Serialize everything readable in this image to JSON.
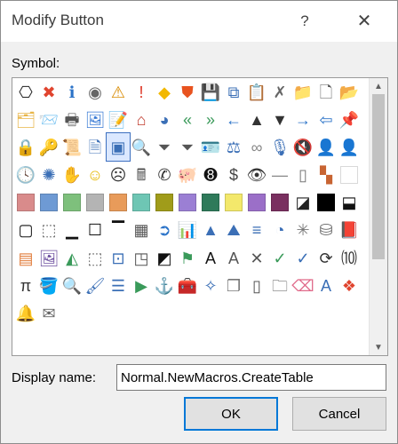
{
  "window": {
    "title": "Modify Button",
    "help_label": "?",
    "close_label": "✕"
  },
  "symbol_section": {
    "label": "Symbol:"
  },
  "symbols": [
    {
      "name": "org-chart-icon",
      "g": "⎔",
      "c": "#222"
    },
    {
      "name": "delete-circle-icon",
      "g": "✖",
      "c": "#e0442e"
    },
    {
      "name": "info-icon",
      "g": "ℹ",
      "c": "#2b73c8"
    },
    {
      "name": "target-icon",
      "g": "◉",
      "c": "#666"
    },
    {
      "name": "warning-icon",
      "g": "⚠",
      "c": "#d88a00"
    },
    {
      "name": "exclamation-icon",
      "g": "!",
      "c": "#d32"
    },
    {
      "name": "warning-diamond-icon",
      "g": "◆",
      "c": "#f2b800"
    },
    {
      "name": "shield-icon",
      "g": "⛊",
      "c": "#e8531f"
    },
    {
      "name": "save-icon",
      "g": "💾",
      "c": "#5b3a8c"
    },
    {
      "name": "copy-icon",
      "g": "⧉",
      "c": "#3b6fb6"
    },
    {
      "name": "paste-icon",
      "g": "📋",
      "c": "#6d4fa0"
    },
    {
      "name": "delete-icon",
      "g": "✗",
      "c": "#666"
    },
    {
      "name": "folder-icon",
      "g": "📁",
      "c": "#e8b64a"
    },
    {
      "name": "page-icon",
      "g": "🗋",
      "c": "#555"
    },
    {
      "name": "open-folder-icon",
      "g": "📂",
      "c": "#e8b64a"
    },
    {
      "name": "folders-icon",
      "g": "🗂",
      "c": "#e8b64a"
    },
    {
      "name": "mail-folder-icon",
      "g": "📨",
      "c": "#e8b64a"
    },
    {
      "name": "print-icon",
      "g": "🖶",
      "c": "#555"
    },
    {
      "name": "image-icon",
      "g": "🖼",
      "c": "#3a7bd5"
    },
    {
      "name": "note-icon",
      "g": "📝",
      "c": "#e2b13c"
    },
    {
      "name": "home-icon",
      "g": "⌂",
      "c": "#c0392b"
    },
    {
      "name": "pie-chart-icon",
      "g": "◕",
      "c": "#3b6fb6"
    },
    {
      "name": "double-left-icon",
      "g": "«",
      "c": "#3a9a5a"
    },
    {
      "name": "double-right-icon",
      "g": "»",
      "c": "#3a9a5a"
    },
    {
      "name": "arrow-left-icon",
      "g": "←",
      "c": "#2b73c8"
    },
    {
      "name": "triangle-up-icon",
      "g": "▲",
      "c": "#333"
    },
    {
      "name": "triangle-down-icon",
      "g": "▼",
      "c": "#333"
    },
    {
      "name": "arrow-right-icon",
      "g": "→",
      "c": "#2b73c8"
    },
    {
      "name": "back-circle-icon",
      "g": "⇦",
      "c": "#2b73c8"
    },
    {
      "name": "pin-icon",
      "g": "📌",
      "c": "#555"
    },
    {
      "name": "lock-icon",
      "g": "🔒",
      "c": "#d4a017"
    },
    {
      "name": "key-icon",
      "g": "🔑",
      "c": "#777"
    },
    {
      "name": "scroll-icon",
      "g": "📜",
      "c": "#777"
    },
    {
      "name": "document-arrow-icon",
      "g": "🗎",
      "c": "#3b6fb6"
    },
    {
      "name": "window-select-icon",
      "g": "▣",
      "c": "#3b6fb6",
      "sel": true
    },
    {
      "name": "magnifier-icon",
      "g": "🔍",
      "c": "#444"
    },
    {
      "name": "filter-icon",
      "g": "⏷",
      "c": "#555"
    },
    {
      "name": "filter2-icon",
      "g": "⏷",
      "c": "#555"
    },
    {
      "name": "contact-card-icon",
      "g": "🪪",
      "c": "#3b6fb6"
    },
    {
      "name": "scales-icon",
      "g": "⚖",
      "c": "#3b6fb6"
    },
    {
      "name": "rings-icon",
      "g": "∞",
      "c": "#888"
    },
    {
      "name": "microphone-icon",
      "g": "🎙",
      "c": "#3b6fb6"
    },
    {
      "name": "mute-icon",
      "g": "🔇",
      "c": "#555"
    },
    {
      "name": "person-tie-icon",
      "g": "👤",
      "c": "#333"
    },
    {
      "name": "person-icon",
      "g": "👤",
      "c": "#555"
    },
    {
      "name": "clock-icon",
      "g": "🕓",
      "c": "#3b6fb6"
    },
    {
      "name": "network-icon",
      "g": "✺",
      "c": "#3b6fb6"
    },
    {
      "name": "hand-icon",
      "g": "✋",
      "c": "#888"
    },
    {
      "name": "smiley-icon",
      "g": "☺",
      "c": "#e6b800"
    },
    {
      "name": "frown-icon",
      "g": "☹",
      "c": "#333"
    },
    {
      "name": "calculator-icon",
      "g": "🖩",
      "c": "#555"
    },
    {
      "name": "phone-icon",
      "g": "✆",
      "c": "#333"
    },
    {
      "name": "piggy-bank-icon",
      "g": "🐖",
      "c": "#777"
    },
    {
      "name": "eight-ball-icon",
      "g": "➑",
      "c": "#111"
    },
    {
      "name": "dollar-icon",
      "g": "$",
      "c": "#444"
    },
    {
      "name": "eye-icon",
      "g": "👁",
      "c": "#333"
    },
    {
      "name": "line-icon",
      "g": "—",
      "c": "#888"
    },
    {
      "name": "blank-page-icon",
      "g": "▯",
      "c": "#777"
    },
    {
      "name": "color-mosaic-icon",
      "g": "▚",
      "c": "#c86432"
    },
    {
      "name": "swatch-white-icon",
      "sw": "#ffffff"
    },
    {
      "name": "swatch-salmon-icon",
      "sw": "#d98b8b"
    },
    {
      "name": "swatch-blue-icon",
      "sw": "#6e9ad4"
    },
    {
      "name": "swatch-green-icon",
      "sw": "#7ec07c"
    },
    {
      "name": "swatch-gray-icon",
      "sw": "#b4b4b4"
    },
    {
      "name": "swatch-orange-icon",
      "sw": "#e89b5a"
    },
    {
      "name": "swatch-teal-icon",
      "sw": "#6ec6b4"
    },
    {
      "name": "swatch-olive-icon",
      "sw": "#a09c1a"
    },
    {
      "name": "swatch-violet-icon",
      "sw": "#9b7fd4"
    },
    {
      "name": "swatch-darkgreen-icon",
      "sw": "#2f7a5a"
    },
    {
      "name": "swatch-yellow-icon",
      "sw": "#f3e86b"
    },
    {
      "name": "swatch-purple-icon",
      "sw": "#9b6fc8"
    },
    {
      "name": "swatch-plum-icon",
      "sw": "#7a3060"
    },
    {
      "name": "swatch-diagonal-icon",
      "g": "◪",
      "c": "#222"
    },
    {
      "name": "swatch-black-icon",
      "sw": "#000000"
    },
    {
      "name": "border-bottom-icon",
      "g": "⬓",
      "c": "#111"
    },
    {
      "name": "border-box-icon",
      "g": "▢",
      "c": "#111"
    },
    {
      "name": "border-dashed-icon",
      "g": "⬚",
      "c": "#666"
    },
    {
      "name": "border-bottom-thick-icon",
      "g": "▁",
      "c": "#111"
    },
    {
      "name": "border-outline-icon",
      "g": "☐",
      "c": "#111"
    },
    {
      "name": "border-top-icon",
      "g": "▔",
      "c": "#111"
    },
    {
      "name": "checker-icon",
      "g": "▦",
      "c": "#555"
    },
    {
      "name": "circle-arrow-right-icon",
      "g": "➲",
      "c": "#2b73c8"
    },
    {
      "name": "bar-chart-icon",
      "g": "📊",
      "c": "#3b6fb6"
    },
    {
      "name": "cone-icon",
      "g": "▲",
      "c": "#3b6fb6"
    },
    {
      "name": "mountain-icon",
      "g": "⛰",
      "c": "#3b6fb6"
    },
    {
      "name": "align-lines-icon",
      "g": "≡",
      "c": "#3b6fb6"
    },
    {
      "name": "pie-piece-icon",
      "g": "◔",
      "c": "#3b6fb6"
    },
    {
      "name": "radar-icon",
      "g": "✳",
      "c": "#777"
    },
    {
      "name": "database-icon",
      "g": "⛁",
      "c": "#666"
    },
    {
      "name": "book-purple-icon",
      "g": "📕",
      "c": "#6d4fa0"
    },
    {
      "name": "orange-box-icon",
      "g": "▤",
      "c": "#e07b39"
    },
    {
      "name": "image-frame-icon",
      "g": "🖼",
      "c": "#6d4fa0"
    },
    {
      "name": "chart-area-icon",
      "g": "◭",
      "c": "#3a9a5a"
    },
    {
      "name": "dotted-page-icon",
      "g": "⬚",
      "c": "#666"
    },
    {
      "name": "portrait-icon",
      "g": "⊡",
      "c": "#3b6fb6"
    },
    {
      "name": "corner-page-icon",
      "g": "◳",
      "c": "#555"
    },
    {
      "name": "diagonal-black-icon",
      "g": "◩",
      "c": "#111"
    },
    {
      "name": "flags-icon",
      "g": "⚑",
      "c": "#3a9a5a"
    },
    {
      "name": "text-a-box-icon",
      "g": "A",
      "c": "#111"
    },
    {
      "name": "text-a-shaded-icon",
      "g": "A",
      "c": "#555"
    },
    {
      "name": "cross-icon",
      "g": "✕",
      "c": "#555"
    },
    {
      "name": "check-icon",
      "g": "✓",
      "c": "#3a9a5a"
    },
    {
      "name": "chart-check-icon",
      "g": "✓",
      "c": "#3b6fb6"
    },
    {
      "name": "refresh-icon",
      "g": "⟳",
      "c": "#333"
    },
    {
      "name": "binary-icon",
      "g": "⑽",
      "c": "#333"
    },
    {
      "name": "pi-icon",
      "g": "π",
      "c": "#333"
    },
    {
      "name": "paint-bucket-icon",
      "g": "🪣",
      "c": "#333"
    },
    {
      "name": "zoom-icon",
      "g": "🔍",
      "c": "#3b6fb6"
    },
    {
      "name": "brush-icon",
      "g": "🖌",
      "c": "#3b6fb6"
    },
    {
      "name": "list-icon",
      "g": "☰",
      "c": "#3b6fb6"
    },
    {
      "name": "play-icon",
      "g": "▶",
      "c": "#3a9a5a"
    },
    {
      "name": "anchor-icon",
      "g": "⚓",
      "c": "#3b6fb6"
    },
    {
      "name": "toolbox-icon",
      "g": "🧰",
      "c": "#333"
    },
    {
      "name": "shape-add-icon",
      "g": "✧",
      "c": "#3b6fb6"
    },
    {
      "name": "copy-pages-icon",
      "g": "❐",
      "c": "#777"
    },
    {
      "name": "tablet-icon",
      "g": "▯",
      "c": "#555"
    },
    {
      "name": "folder-outline-icon",
      "g": "🗀",
      "c": "#555"
    },
    {
      "name": "eraser-icon",
      "g": "⌫",
      "c": "#e06a8a"
    },
    {
      "name": "text-style-icon",
      "g": "A",
      "c": "#3b6fb6"
    },
    {
      "name": "ms-logo-icon",
      "g": "❖",
      "c": "#e0442e"
    },
    {
      "name": "bell-icon",
      "g": "🔔",
      "c": "#e2b13c"
    },
    {
      "name": "envelope-open-icon",
      "g": "✉",
      "c": "#666"
    }
  ],
  "display_name": {
    "label": "Display name:",
    "value": "Normal.NewMacros.CreateTable"
  },
  "buttons": {
    "ok": "OK",
    "cancel": "Cancel"
  },
  "scrollbar": {
    "up_label": "▲",
    "down_label": "▼"
  }
}
